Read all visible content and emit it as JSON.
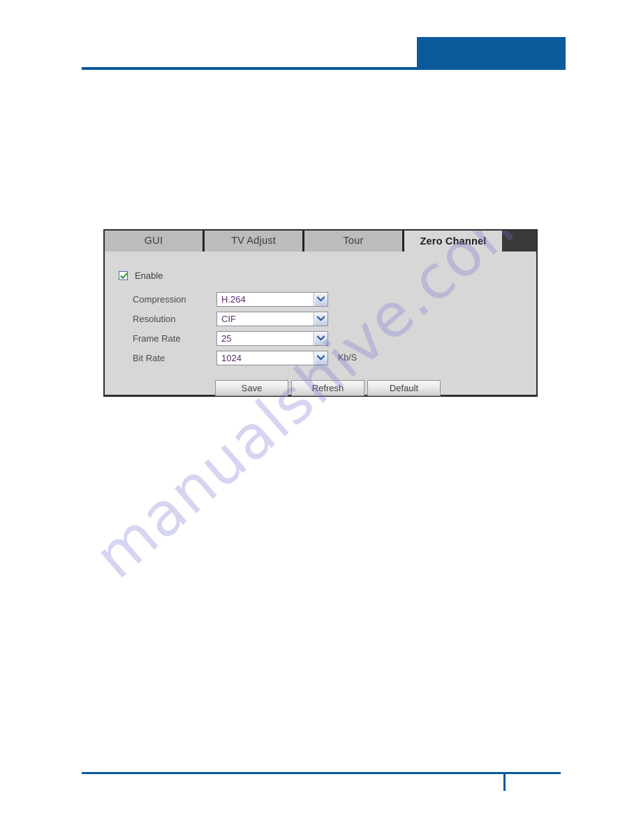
{
  "colors": {
    "accent_blue": "#0a5a9c",
    "panel_border": "#2f2f2f",
    "tab_inactive_bg": "#bcbcbc",
    "tab_active_bg": "#d7d7d7",
    "select_value_text": "#5a2a6e",
    "checkbox_border": "#4a6fa8",
    "checkmark_green": "#2fa02f",
    "watermark": "#7874d2"
  },
  "watermark": {
    "text": "manualshive.com"
  },
  "panel": {
    "tabs": [
      {
        "label": "GUI",
        "active": false
      },
      {
        "label": "TV Adjust",
        "active": false
      },
      {
        "label": "Tour",
        "active": false
      },
      {
        "label": "Zero Channel",
        "active": true
      }
    ],
    "enable": {
      "label": "Enable",
      "checked": true
    },
    "fields": [
      {
        "label": "Compression",
        "value": "H.264",
        "unit": ""
      },
      {
        "label": "Resolution",
        "value": "CIF",
        "unit": ""
      },
      {
        "label": "Frame Rate",
        "value": "25",
        "unit": ""
      },
      {
        "label": "Bit Rate",
        "value": "1024",
        "unit": "Kb/S"
      }
    ],
    "buttons": [
      {
        "label": "Save"
      },
      {
        "label": "Refresh"
      },
      {
        "label": "Default"
      }
    ]
  }
}
